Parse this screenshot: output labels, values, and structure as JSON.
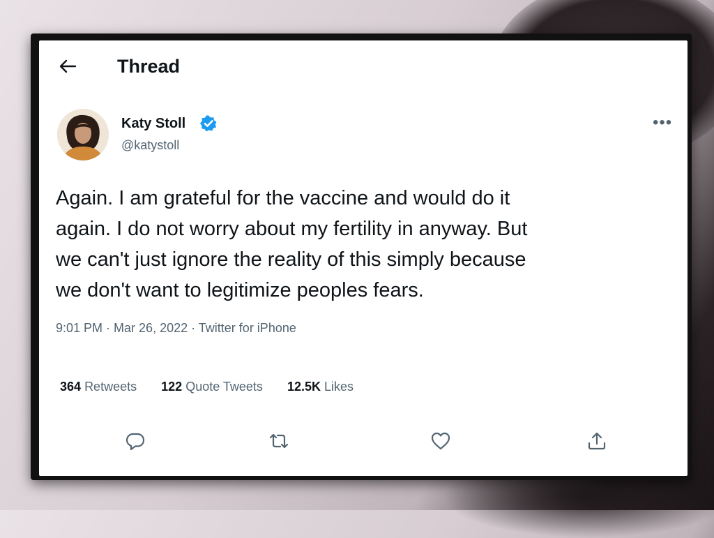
{
  "header": {
    "title": "Thread",
    "back_icon": "arrow-left-icon"
  },
  "author": {
    "name": "Katy Stoll",
    "handle": "@katystoll",
    "verified": true
  },
  "tweet": {
    "lines": [
      "Again. I am grateful for the vaccine and would do it",
      "again. I do not worry about my fertility in anyway. But",
      "we can't just ignore the reality of this simply because",
      "we don't want to legitimize peoples fears."
    ]
  },
  "meta": {
    "time": "9:01 PM",
    "date": "Mar 26, 2022",
    "source": "Twitter for iPhone",
    "separator": " · "
  },
  "stats": {
    "retweets": {
      "count": "364",
      "label": "Retweets"
    },
    "quotes": {
      "count": "122",
      "label": "Quote Tweets"
    },
    "likes": {
      "count": "12.5K",
      "label": "Likes"
    }
  },
  "actions": [
    "reply-icon",
    "retweet-icon",
    "like-icon",
    "share-icon"
  ],
  "colors": {
    "text": "#0f1419",
    "secondary": "#536471",
    "verified": "#1d9bf0"
  }
}
